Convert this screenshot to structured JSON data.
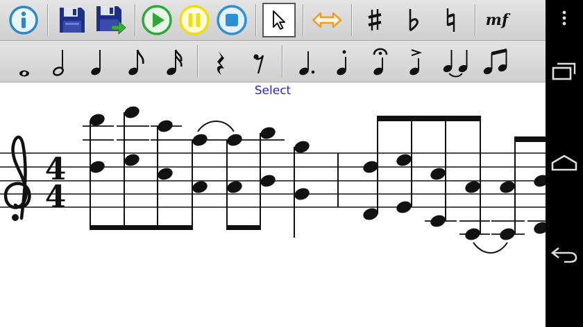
{
  "toolbar1": {
    "buttons": [
      {
        "name": "info-button",
        "icon": "info-icon"
      },
      {
        "name": "save-button",
        "icon": "floppy-disk-icon"
      },
      {
        "name": "save-as-button",
        "icon": "floppy-disk-export-icon"
      },
      {
        "name": "play-button",
        "icon": "play-icon"
      },
      {
        "name": "pause-button",
        "icon": "pause-icon"
      },
      {
        "name": "stop-button",
        "icon": "stop-icon"
      },
      {
        "name": "select-tool-button",
        "icon": "cursor-arrow-icon",
        "selected": true
      },
      {
        "name": "move-tool-button",
        "icon": "horizontal-arrows-icon"
      },
      {
        "name": "sharp-button",
        "icon": "sharp-icon"
      },
      {
        "name": "flat-button",
        "icon": "flat-icon"
      },
      {
        "name": "natural-button",
        "icon": "natural-icon"
      },
      {
        "name": "dynamics-button",
        "icon": "dynamic-mark-icon",
        "label": "mf"
      }
    ]
  },
  "toolbar2": {
    "buttons": [
      {
        "name": "whole-note-button",
        "icon": "whole-note-icon"
      },
      {
        "name": "half-note-button",
        "icon": "half-note-icon"
      },
      {
        "name": "quarter-note-button",
        "icon": "quarter-note-icon"
      },
      {
        "name": "eighth-note-button",
        "icon": "eighth-note-icon"
      },
      {
        "name": "sixteenth-note-button",
        "icon": "sixteenth-note-icon"
      },
      {
        "name": "quarter-rest-button",
        "icon": "quarter-rest-icon"
      },
      {
        "name": "eighth-rest-button",
        "icon": "eighth-rest-icon"
      },
      {
        "name": "dotted-note-button",
        "icon": "dotted-note-icon"
      },
      {
        "name": "staccato-button",
        "icon": "staccato-icon"
      },
      {
        "name": "fermata-button",
        "icon": "fermata-icon"
      },
      {
        "name": "accent-button",
        "icon": "accent-icon"
      },
      {
        "name": "tie-button",
        "icon": "tie-icon"
      },
      {
        "name": "beam-button",
        "icon": "beam-icon"
      }
    ]
  },
  "status": {
    "mode": "Select"
  },
  "score": {
    "clef": "treble",
    "time_signature": {
      "top": "4",
      "bottom": "4"
    }
  },
  "navbar": {
    "buttons": [
      {
        "name": "overflow-menu-button",
        "icon": "overflow-menu-icon"
      },
      {
        "name": "recent-apps-button",
        "icon": "recent-apps-icon"
      },
      {
        "name": "home-button",
        "icon": "home-icon"
      },
      {
        "name": "back-button",
        "icon": "back-icon"
      }
    ]
  },
  "colors": {
    "toolbar_bg": "#d8d8d8",
    "info_blue": "#2a88c8",
    "save_navy": "#1e2f86",
    "play_green": "#2fa83a",
    "pause_yellow": "#f0e000",
    "stop_blue": "#2d8fd6",
    "move_orange": "#f29a1c",
    "status_text": "#2a2ab8",
    "navbar_bg": "#000000"
  }
}
